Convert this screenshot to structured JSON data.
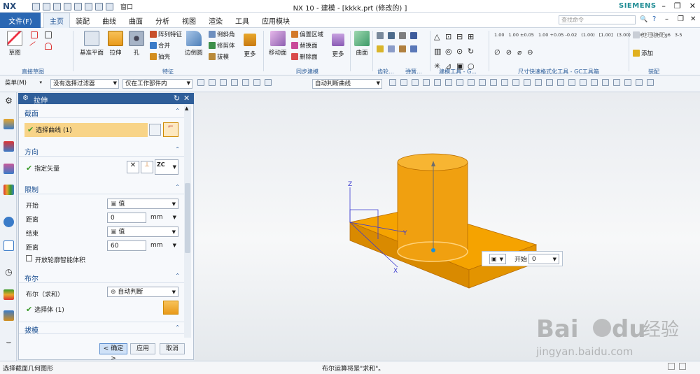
{
  "app": {
    "logo": "NX",
    "window_title": "NX 10 - 建模 - [kkkk.prt (修改的) ]",
    "brand": "SIEMENS",
    "window_menu": "窗口"
  },
  "tabs": [
    "主页",
    "装配",
    "曲线",
    "曲面",
    "分析",
    "视图",
    "渲染",
    "工具",
    "应用模块"
  ],
  "file_tab": "文件(F)",
  "active_tab": "主页",
  "search_placeholder": "查找命令",
  "ribbon": {
    "groups": [
      {
        "label": "直接草图",
        "items": [
          "草图"
        ]
      },
      {
        "label": "特征",
        "items": [
          "基准平面",
          "拉伸",
          "孔",
          "阵列特征",
          "合并",
          "抽壳",
          "边倒圆",
          "倒斜角",
          "修剪体",
          "拔模",
          "更多"
        ]
      },
      {
        "label": "同步建模",
        "items": [
          "移动面",
          "偏置区域",
          "替换面",
          "删除面",
          "更多"
        ]
      },
      {
        "label": "齿轮...",
        "items": [
          "曲面"
        ]
      },
      {
        "label": "弹簧...",
        "items": []
      },
      {
        "label": "建模工具 - G...",
        "items": []
      },
      {
        "label": "尺寸快速格式化工具 - GC工具箱",
        "items": [
          "1.00",
          "1.00 ±0.05",
          "1.00 +0.05 -0.02",
          "(1.00)",
          "[1.00]",
          "(3.00)",
          "10H7",
          "10H7 g6",
          "3-5"
        ]
      },
      {
        "label": "装配",
        "items": [
          "处理装配",
          "添加"
        ]
      }
    ]
  },
  "toolbar": {
    "menu": "菜单(M)",
    "filter": "没有选择过滤器",
    "scope": "仅在工作部件内",
    "curve_rule": "自动判断曲线"
  },
  "dialog": {
    "title": "拉伸",
    "section": {
      "header": "截面",
      "select_curve": "选择曲线 (1)"
    },
    "direction": {
      "header": "方向",
      "vector_label": "指定矢量",
      "vector_value": "ZC"
    },
    "limits": {
      "header": "限制",
      "start_label": "开始",
      "start_value": "值",
      "distance_label": "距离",
      "start_distance": "0",
      "unit": "mm",
      "end_label": "结束",
      "end_value": "值",
      "end_distance": "60",
      "open_profile_label": "开放轮廓智能体积"
    },
    "boolean": {
      "header": "布尔",
      "bool_label": "布尔（求和）",
      "bool_value": "自动判断",
      "select_body": "选择体 (1)"
    },
    "draft": {
      "header": "拔模"
    },
    "ok": "< 确定 >",
    "apply": "应用",
    "cancel": "取消"
  },
  "viewport": {
    "float_label": "开始",
    "float_value": "0",
    "axis_x": "X",
    "axis_y": "Y",
    "axis_z": "Z"
  },
  "status": {
    "left": "选择截面几何图形",
    "center": "布尔运算将是\"求和\"。"
  },
  "watermark": {
    "brand": "Bai",
    "brand2": "du",
    "cn": "经验",
    "url": "jingyan.baidu.com"
  },
  "colors": {
    "accent": "#2a67b3",
    "model": "#f5a300",
    "cylinder": "#f0a010",
    "dialog_header": "#2f5e99",
    "selected_row": "#f8d488"
  }
}
